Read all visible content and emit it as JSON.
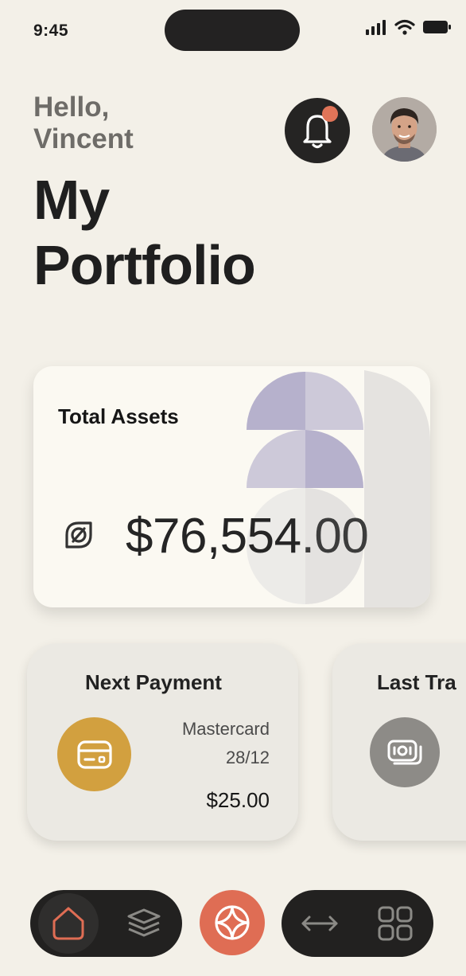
{
  "status_bar": {
    "time": "9:45"
  },
  "header": {
    "greeting_line1": "Hello,",
    "greeting_line2": "Vincent",
    "title_line1": "My",
    "title_line2": "Portfolio"
  },
  "assets": {
    "label": "Total Assets",
    "amount_main": "$76,554",
    "amount_cents": ".00",
    "icon": "leaf-icon"
  },
  "cards": [
    {
      "title": "Next Payment",
      "brand": "Mastercard",
      "date": "28/12",
      "amount": "$25.00",
      "icon": "credit-card-icon",
      "color": "#d2a03f"
    },
    {
      "title": "Last Tra",
      "icon": "cash-icon",
      "color": "#8d8b87"
    }
  ],
  "nav": {
    "items": [
      "home-icon",
      "layers-icon",
      "compass-icon",
      "transfer-icon",
      "grid-icon"
    ],
    "active": "home-icon",
    "accent": "#df6d54"
  },
  "colors": {
    "background": "#f3f0e8",
    "notification_dot": "#e07458",
    "dark": "#222120"
  }
}
